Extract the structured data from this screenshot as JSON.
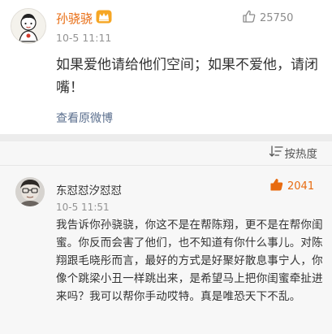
{
  "post": {
    "author": "孙骁骁",
    "time": "10-5 11:11",
    "likes": "25750",
    "text": "如果爱他请给他们空间；如果不爱他，请闭嘴！",
    "view_original": "查看原微博"
  },
  "comments_header": {
    "sort_label": "按热度"
  },
  "comments": [
    {
      "author": "东怼怼汐怼怼",
      "time": "10-5 11:51",
      "likes": "2041",
      "text": "我告诉你孙骁骁，你这不是在帮陈翔，更不是在帮你闺蜜。你反而会害了他们，也不知道有你什么事儿。对陈翔跟毛晓彤而言，最好的方式是好聚好散息事宁人，你像个跳梁小丑一样跳出来，是希望马上把你闺蜜牵扯进来吗？我可以帮你手动哎特。真是唯恐天下不乱。"
    }
  ],
  "icons": {
    "like": "thumb-up-icon",
    "sort": "sort-lines-icon",
    "badge": "crown-badge-icon"
  },
  "colors": {
    "author_name": "#e86b10",
    "link": "#5b6f8e",
    "liked_count": "#e86b10",
    "meta_gray": "#939393",
    "page_bg": "#f2f2f2"
  }
}
